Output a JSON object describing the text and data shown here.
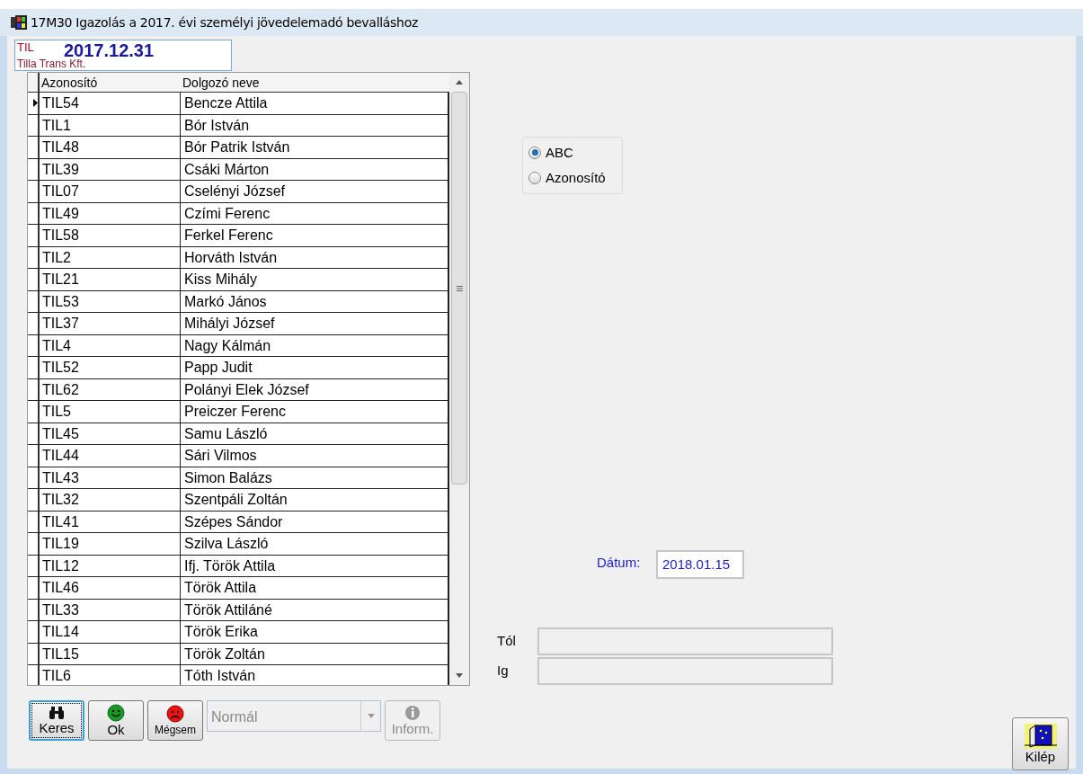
{
  "window": {
    "title": "17M30 Igazolás a 2017. évi személyi jövedelemadó bevalláshoz"
  },
  "company": {
    "code": "TIL",
    "date": "2017.12.31",
    "name": "Tilla Trans Kft."
  },
  "table": {
    "columns": [
      "Azonosító",
      "Dolgozó neve"
    ],
    "rows": [
      {
        "id": "TIL54",
        "name": "Bencze Attila",
        "selected": true
      },
      {
        "id": "TIL1",
        "name": "Bór István",
        "selected": false
      },
      {
        "id": "TIL48",
        "name": "Bór Patrik István",
        "selected": false
      },
      {
        "id": "TIL39",
        "name": "Csáki Márton",
        "selected": false
      },
      {
        "id": "TIL07",
        "name": "Cselényi József",
        "selected": false
      },
      {
        "id": "TIL49",
        "name": "Czími Ferenc",
        "selected": false
      },
      {
        "id": "TIL58",
        "name": "Ferkel Ferenc",
        "selected": false
      },
      {
        "id": "TIL2",
        "name": "Horváth István",
        "selected": false
      },
      {
        "id": "TIL21",
        "name": "Kiss Mihály",
        "selected": false
      },
      {
        "id": "TIL53",
        "name": "Markó János",
        "selected": false
      },
      {
        "id": "TIL37",
        "name": "Mihályi József",
        "selected": false
      },
      {
        "id": "TIL4",
        "name": "Nagy Kálmán",
        "selected": false
      },
      {
        "id": "TIL52",
        "name": "Papp Judit",
        "selected": false
      },
      {
        "id": "TIL62",
        "name": "Polányi Elek József",
        "selected": false
      },
      {
        "id": "TIL5",
        "name": "Preiczer Ferenc",
        "selected": false
      },
      {
        "id": "TIL45",
        "name": "Samu László",
        "selected": false
      },
      {
        "id": "TIL44",
        "name": "Sári Vilmos",
        "selected": false
      },
      {
        "id": "TIL43",
        "name": "Simon Balázs",
        "selected": false
      },
      {
        "id": "TIL32",
        "name": "Szentpáli Zoltán",
        "selected": false
      },
      {
        "id": "TIL41",
        "name": "Szépes Sándor",
        "selected": false
      },
      {
        "id": "TIL19",
        "name": "Szilva László",
        "selected": false
      },
      {
        "id": "TIL12",
        "name": "Ifj. Török Attila",
        "selected": false
      },
      {
        "id": "TIL46",
        "name": "Török Attila",
        "selected": false
      },
      {
        "id": "TIL33",
        "name": "Török Attiláné",
        "selected": false
      },
      {
        "id": "TIL14",
        "name": "Török Erika",
        "selected": false
      },
      {
        "id": "TIL15",
        "name": "Török Zoltán",
        "selected": false
      },
      {
        "id": "TIL6",
        "name": "Tóth István",
        "selected": false
      }
    ]
  },
  "sort_options": [
    {
      "label": "ABC",
      "selected": true
    },
    {
      "label": "Azonosító",
      "selected": false
    }
  ],
  "date_field": {
    "label": "Dátum:",
    "value": "2018.01.15"
  },
  "range": [
    {
      "label": "Tól"
    },
    {
      "label": "Ig"
    }
  ],
  "buttons": [
    {
      "kind": "search",
      "label": "Keres",
      "focused": true
    },
    {
      "kind": "ok",
      "label": "Ok",
      "focused": false
    },
    {
      "kind": "cancel",
      "label": "Mégsem",
      "focused": false
    }
  ],
  "mode_select": {
    "value": "Normál",
    "disabled": true
  },
  "info_button": {
    "label": "Inform.",
    "disabled": true
  },
  "exit_button": {
    "label": "Kilép"
  }
}
